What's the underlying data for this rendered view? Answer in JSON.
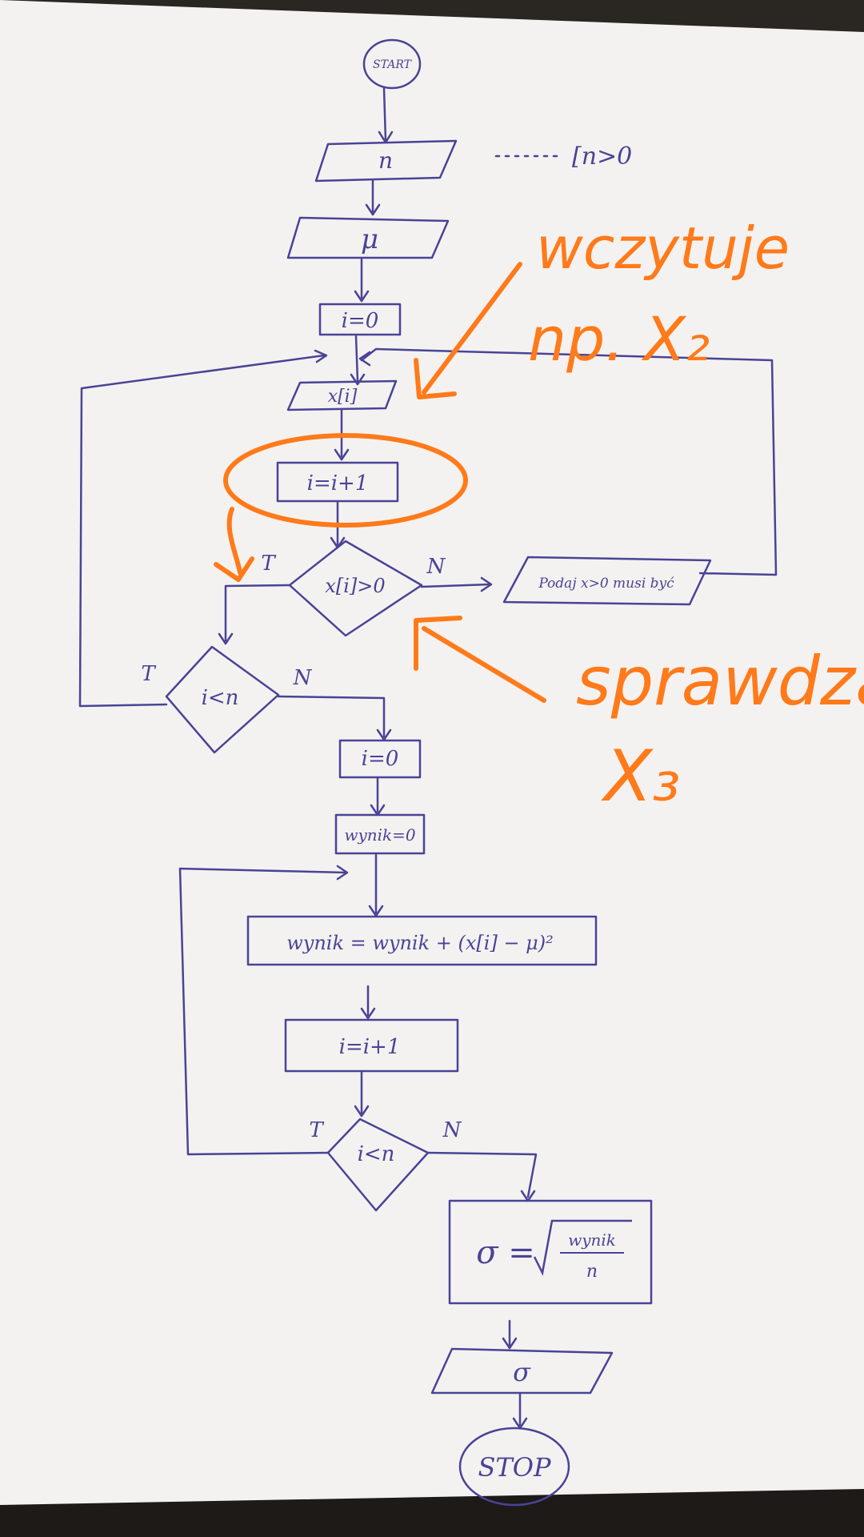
{
  "colors": {
    "paper": "#f4f2f0",
    "ink": "#4a4396",
    "marker": "#ff7a1a",
    "background": "#2a2622"
  },
  "flowchart": {
    "start": "START",
    "input_n": "n",
    "input_condition": "[n>0",
    "input_mu": "μ",
    "init_i": "i=0",
    "input_xi": "x[i]",
    "increment_i": "i=i+1",
    "decision_xi": "x[i]>0",
    "label_true": "T",
    "label_false": "N",
    "error_output": "Podaj x>0 musi być",
    "decision_loop": "i<n",
    "reset_i": "i=0",
    "init_wynik": "wynik=0",
    "accumulate": "wynik = wynik + (x[i] − μ)²",
    "increment_i2": "i=i+1",
    "decision_loop2": "i<n",
    "sigma_formula_left": "σ =",
    "sigma_numerator": "wynik",
    "sigma_denominator": "n",
    "output_sigma": "σ",
    "stop": "STOP"
  },
  "annotations": {
    "reads_line1": "wczytuje",
    "reads_line2": "np. X₂",
    "checks_line1": "sprawdza",
    "checks_line2": "X₃"
  }
}
